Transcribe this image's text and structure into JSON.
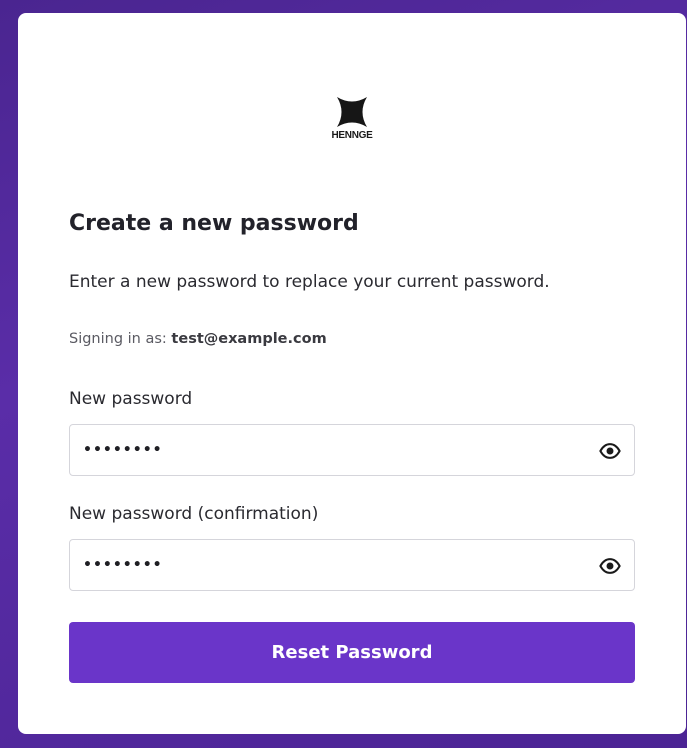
{
  "brand": {
    "logo_icon": "henngestar-icon",
    "name": "HENNGE"
  },
  "heading": {
    "title": "Create a new password",
    "subtitle": "Enter a new password to replace your current password."
  },
  "signin": {
    "prefix": "Signing in as: ",
    "email": "test@example.com"
  },
  "fields": {
    "new_password": {
      "label": "New password",
      "value": "••••••••",
      "type": "password",
      "toggle_icon": "eye-icon"
    },
    "confirm_password": {
      "label": "New password (confirmation)",
      "value": "••••••••",
      "type": "password",
      "toggle_icon": "eye-icon"
    }
  },
  "actions": {
    "submit_label": "Reset Password"
  },
  "colors": {
    "background": "#5a2da8",
    "primary_button": "#6a35c9",
    "card": "#ffffff"
  }
}
